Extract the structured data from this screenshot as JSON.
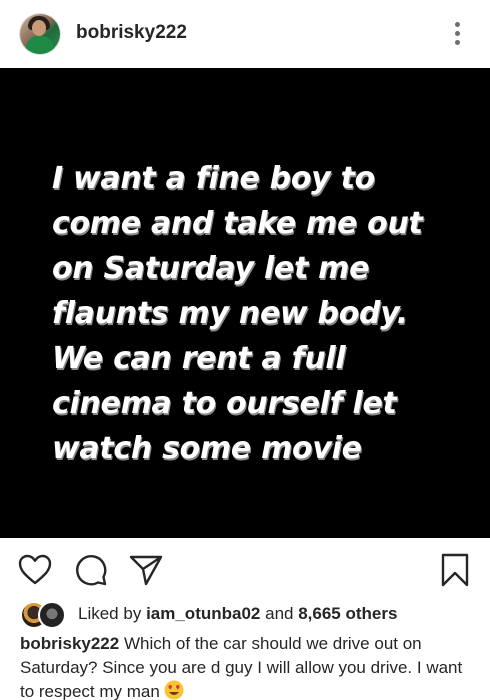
{
  "header": {
    "username": "bobrisky222",
    "avatar_icon": "profile-avatar",
    "more_icon": "more-vertical-icon"
  },
  "image": {
    "text": "I want a fine boy to\ncome and take me out\non Saturday let me\nflaunts my new body.\nWe can rent a full\ncinema to ourself let\nwatch some movie",
    "background": "#000000",
    "text_color": "#ffffff"
  },
  "actions": {
    "like_icon": "heart-icon",
    "comment_icon": "comment-icon",
    "share_icon": "send-icon",
    "save_icon": "bookmark-icon"
  },
  "likes": {
    "prefix": "Liked by",
    "user": "iam_otunba02",
    "conjunction": "and",
    "others": "8,665 others"
  },
  "caption": {
    "username": "bobrisky222",
    "text": "Which of the car should we drive out on Saturday? Since you are d guy I will allow you drive. I want to respect my man",
    "emoji": "heart-eyes-emoji"
  }
}
